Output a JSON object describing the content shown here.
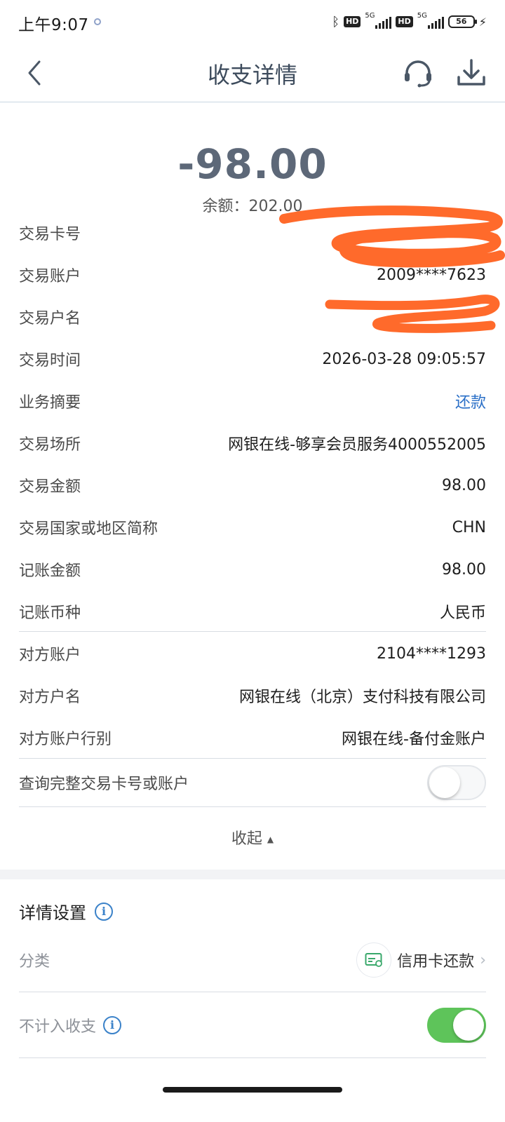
{
  "status_bar": {
    "time": "上午9:07",
    "net1": "5G",
    "net2": "5G",
    "hd": "HD",
    "battery": "56"
  },
  "header": {
    "title": "收支详情",
    "back_icon": "chevron-left-icon",
    "service_icon": "headset-icon",
    "download_icon": "download-icon"
  },
  "summary": {
    "amount": "-98.00",
    "balance": "余额：202.00"
  },
  "details": [
    {
      "label": "交易卡号",
      "value": ""
    },
    {
      "label": "交易账户",
      "value": "2009****7623"
    },
    {
      "label": "交易户名",
      "value": ""
    },
    {
      "label": "交易时间",
      "value": "2026-03-28 09:05:57"
    },
    {
      "label": "业务摘要",
      "value": "还款"
    },
    {
      "label": "交易场所",
      "value": "网银在线-够享会员服务4000552005"
    },
    {
      "label": "交易金额",
      "value": "98.00"
    },
    {
      "label": "交易国家或地区简称",
      "value": "CHN"
    },
    {
      "label": "记账金额",
      "value": "98.00"
    },
    {
      "label": "记账币种",
      "value": "人民币"
    }
  ],
  "counterparty": [
    {
      "label": "对方账户",
      "value": "2104****1293"
    },
    {
      "label": "对方户名",
      "value": "网银在线（北京）支付科技有限公司"
    },
    {
      "label": "对方账户行别",
      "value": "网银在线-备付金账户"
    }
  ],
  "full_number_toggle": {
    "label": "查询完整交易卡号或账户",
    "on": false
  },
  "collapse_label": "收起",
  "settings": {
    "title": "详情设置",
    "category_label": "分类",
    "category_value": "信用卡还款",
    "exclude_label": "不计入收支",
    "exclude_on": true
  },
  "colors": {
    "accent_link": "#2a6fc7",
    "toggle_on": "#5ec45a",
    "redaction": "#ff6a2b"
  }
}
